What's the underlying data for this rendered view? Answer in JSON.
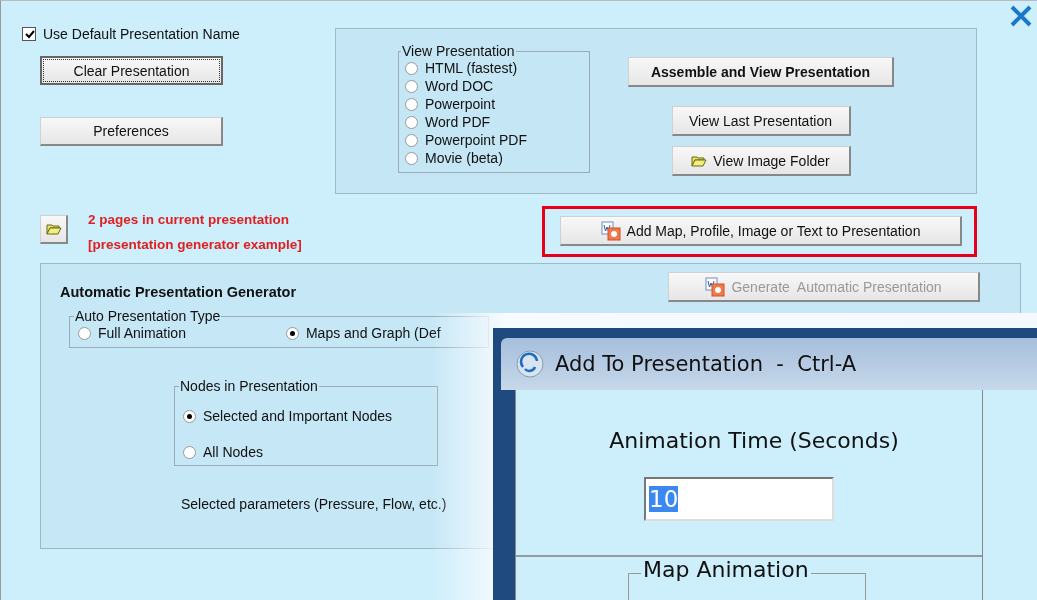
{
  "use_default_name": {
    "label": "Use Default Presentation Name",
    "checked": true
  },
  "left_buttons": [
    {
      "label": "Clear Presentation",
      "focused": true
    },
    {
      "label": "Preferences",
      "focused": false
    }
  ],
  "view_presentation": {
    "title": "View Presentation",
    "options": [
      {
        "label": "HTML (fastest)",
        "selected": false
      },
      {
        "label": "Word DOC",
        "selected": false
      },
      {
        "label": "Powerpoint",
        "selected": false
      },
      {
        "label": "Word PDF",
        "selected": false
      },
      {
        "label": "Powerpoint PDF",
        "selected": false
      },
      {
        "label": "Movie (beta)",
        "selected": false
      }
    ]
  },
  "assemble_button": "Assemble and View Presentation",
  "view_last_button": "View Last Presentation",
  "view_image_folder_button": "View Image Folder",
  "status_lines": [
    "2 pages in current presentation",
    "[presentation generator example]"
  ],
  "add_button": {
    "label": "Add Map, Profile, Image or Text to Presentation",
    "highlighted": true
  },
  "generator": {
    "title": "Automatic Presentation Generator",
    "generate_button": {
      "label": "Generate  Automatic Presentation",
      "disabled": true
    },
    "type_group": {
      "title": "Auto Presentation Type",
      "options": [
        {
          "label": "Full Animation",
          "selected": false
        },
        {
          "label": "Maps and Graph (Def",
          "selected": true
        }
      ]
    },
    "nodes_group": {
      "title": "Nodes in Presentation",
      "options": [
        {
          "label": "Selected and Important Nodes",
          "selected": true
        },
        {
          "label": "All Nodes",
          "selected": false
        }
      ]
    },
    "note": "Selected parameters (Pressure, Flow, etc.)"
  },
  "dialog": {
    "title": "Add To Presentation  -  Ctrl-A",
    "animation_time_label": "Animation Time (Seconds)",
    "animation_time_value": "10",
    "map_animation_title": "Map Animation"
  }
}
